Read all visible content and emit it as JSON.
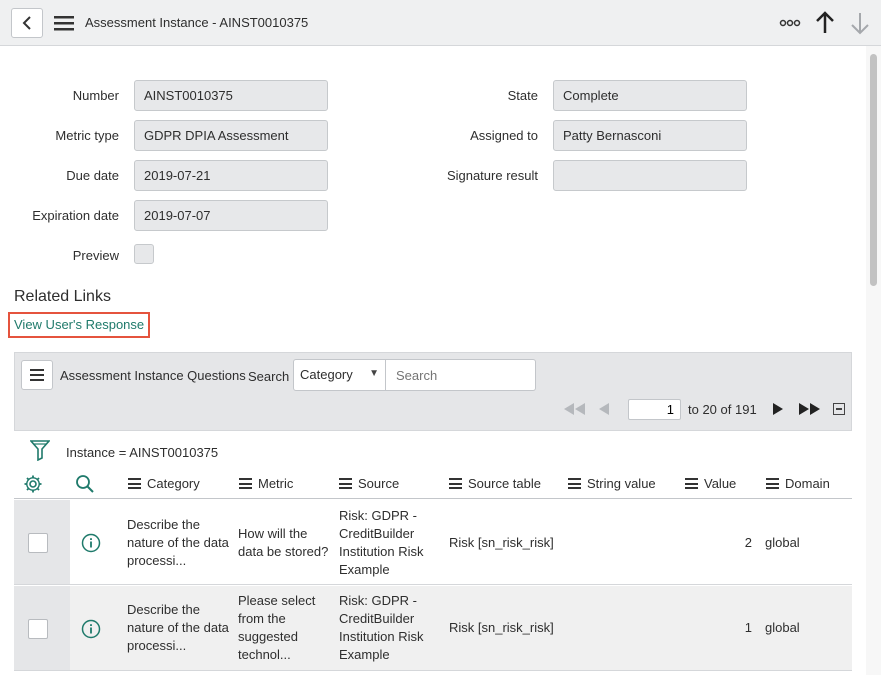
{
  "header": {
    "title": "Assessment Instance - AINST0010375"
  },
  "form": {
    "number_label": "Number",
    "number_value": "AINST0010375",
    "metric_type_label": "Metric type",
    "metric_type_value": "GDPR DPIA Assessment",
    "due_date_label": "Due date",
    "due_date_value": "2019-07-21",
    "expiration_date_label": "Expiration date",
    "expiration_date_value": "2019-07-07",
    "preview_label": "Preview",
    "state_label": "State",
    "state_value": "Complete",
    "assigned_to_label": "Assigned to",
    "assigned_to_value": "Patty Bernasconi",
    "signature_result_label": "Signature result",
    "signature_result_value": ""
  },
  "related_links": {
    "title": "Related Links",
    "link": "View User's Response"
  },
  "list": {
    "title": "Assessment Instance Questions",
    "search_label": "Search",
    "search_field": "Category",
    "search_placeholder": "Search",
    "page_value": "1",
    "page_range": "to 20 of 191",
    "breadcrumb": "Instance = AINST0010375",
    "columns": [
      "Category",
      "Metric",
      "Source",
      "Source table",
      "String value",
      "Value",
      "Domain"
    ],
    "rows": [
      {
        "category": [
          "Describe the",
          "nature of the data",
          "processi..."
        ],
        "metric": [
          "How will the",
          "data be stored?"
        ],
        "source": [
          "Risk: GDPR -",
          "CreditBuilder",
          "Institution Risk",
          "Example"
        ],
        "source_table": "Risk [sn_risk_risk]",
        "string_value": "",
        "value": "2",
        "domain": "global"
      },
      {
        "category": [
          "Describe the",
          "nature of the data",
          "processi..."
        ],
        "metric": [
          "Please select",
          "from the",
          "suggested",
          "technol..."
        ],
        "source": [
          "Risk: GDPR -",
          "CreditBuilder",
          "Institution Risk",
          "Example"
        ],
        "source_table": "Risk [sn_risk_risk]",
        "string_value": "",
        "value": "1",
        "domain": "global"
      }
    ]
  },
  "colors": {
    "header_bg": "#eff0f1",
    "field_bg": "#e7e8ea",
    "link": "#1f7a6b",
    "highlight_border": "#e5533d",
    "icon_teal": "#1f7a6b"
  }
}
